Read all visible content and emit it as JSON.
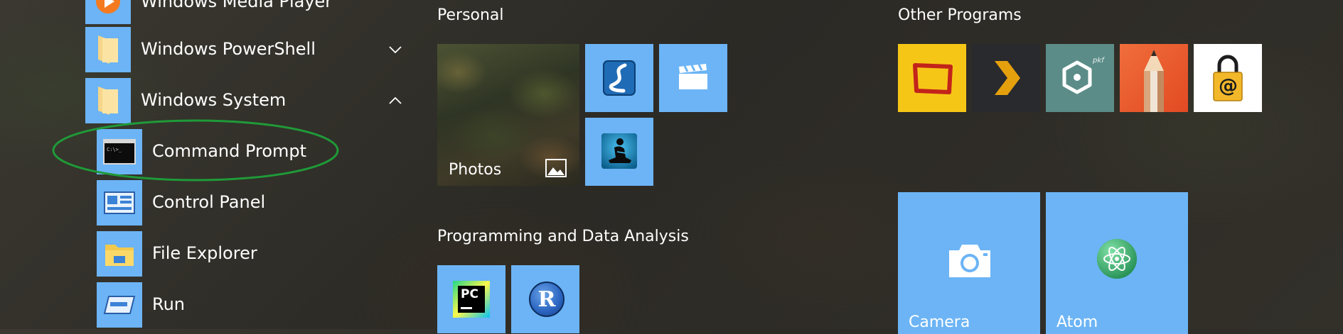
{
  "app_list": {
    "items": [
      {
        "label": "Windows Media Player",
        "icon": "media-player-icon"
      },
      {
        "label": "Windows PowerShell",
        "icon": "folder-icon",
        "expander": "chevron-down-icon"
      },
      {
        "label": "Windows System",
        "icon": "folder-icon",
        "expander": "chevron-up-icon"
      },
      {
        "label": "Command Prompt",
        "icon": "command-prompt-icon",
        "highlighted": true
      },
      {
        "label": "Control Panel",
        "icon": "control-panel-icon"
      },
      {
        "label": "File Explorer",
        "icon": "file-explorer-icon"
      },
      {
        "label": "Run",
        "icon": "run-icon"
      }
    ]
  },
  "groups": {
    "personal": {
      "title": "Personal",
      "tiles": [
        {
          "label": "Photos",
          "icon": "photo-icon"
        },
        {
          "label": "",
          "icon": "river-app-icon"
        },
        {
          "label": "",
          "icon": "video-clapper-icon"
        },
        {
          "label": "",
          "icon": "kindle-reader-icon"
        }
      ]
    },
    "programming": {
      "title": "Programming and Data Analysis",
      "tiles": [
        {
          "label": "",
          "icon": "pycharm-icon",
          "text": "PC"
        },
        {
          "label": "",
          "icon": "r-language-icon",
          "text": "R"
        }
      ]
    },
    "other": {
      "title": "Other Programs",
      "tiles": [
        {
          "label": "",
          "icon": "frame-app-icon"
        },
        {
          "label": "",
          "icon": "plex-icon"
        },
        {
          "label": "",
          "icon": "hexagon-pkf-icon",
          "text": "pkf"
        },
        {
          "label": "",
          "icon": "pencil-app-icon"
        },
        {
          "label": "",
          "icon": "mail-lock-icon",
          "text": "@"
        },
        {
          "label": "Camera",
          "icon": "camera-icon"
        },
        {
          "label": "Atom",
          "icon": "atom-icon"
        }
      ]
    }
  },
  "colors": {
    "tile_blue": "#6cb4f5",
    "highlight_ellipse": "#1f9a38",
    "background": "#2e2c27"
  }
}
